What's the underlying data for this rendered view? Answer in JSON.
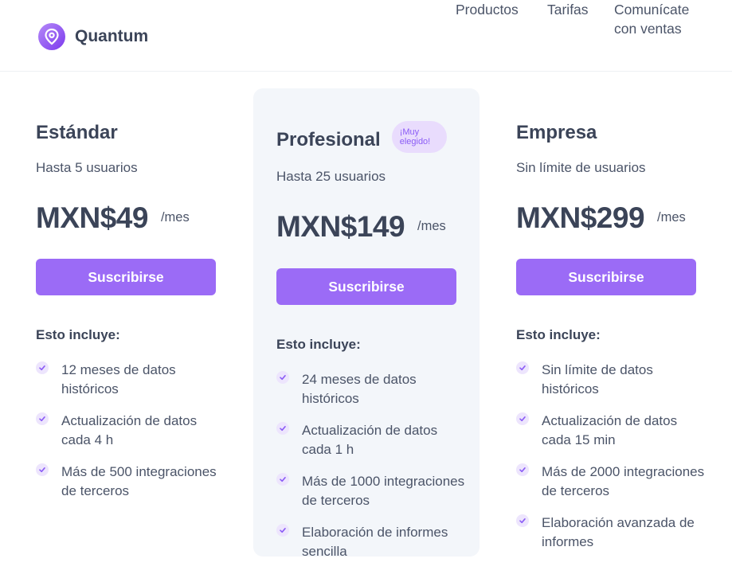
{
  "brand": {
    "name": "Quantum"
  },
  "nav": {
    "items": [
      "Productos",
      "Tarifas",
      "Comunícate con ventas"
    ]
  },
  "plans": [
    {
      "name": "Estándar",
      "users": "Hasta 5 usuarios",
      "price": "MXN$49",
      "period": "/mes",
      "cta": "Suscribirse",
      "includes_label": "Esto incluye:",
      "features": [
        "12 meses de datos históricos",
        "Actualización de datos cada 4 h",
        "Más de 500 integraciones de terceros"
      ]
    },
    {
      "name": "Profesional",
      "badge": "¡Muy elegido!",
      "users": "Hasta 25 usuarios",
      "price": "MXN$149",
      "period": "/mes",
      "cta": "Suscribirse",
      "includes_label": "Esto incluye:",
      "features": [
        "24 meses de datos históricos",
        "Actualización de datos cada 1 h",
        "Más de 1000 integraciones de terceros",
        "Elaboración de informes sencilla"
      ]
    },
    {
      "name": "Empresa",
      "users": "Sin límite de usuarios",
      "price": "MXN$299",
      "period": "/mes",
      "cta": "Suscribirse",
      "includes_label": "Esto incluye:",
      "features": [
        "Sin límite de datos históricos",
        "Actualización de datos cada 15 min",
        "Más de 2000 integraciones de terceros",
        "Elaboración avanzada de informes"
      ]
    }
  ],
  "colors": {
    "accent": "#9b6bf6",
    "featured_bg": "#f3f6fa",
    "text": "#3b4458",
    "check_bg": "#ede5fd",
    "badge_bg": "#e9dcfd"
  },
  "icons": {
    "logo": "location-pin-icon",
    "feature": "checkmark-icon"
  }
}
